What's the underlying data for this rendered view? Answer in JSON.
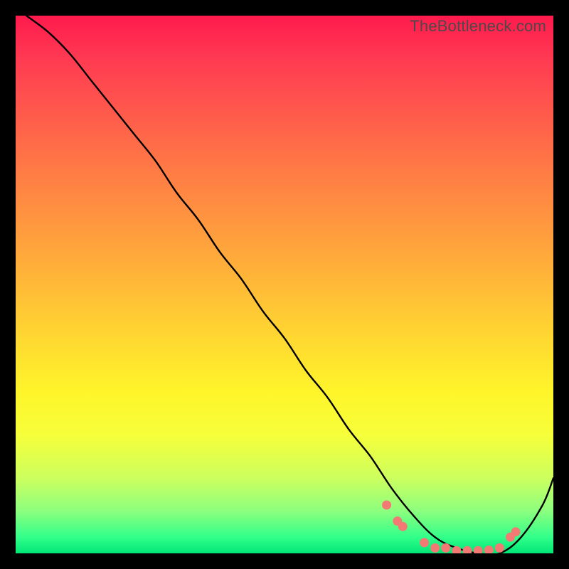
{
  "watermark": "TheBottleneck.com",
  "chart_data": {
    "type": "line",
    "title": "",
    "xlabel": "",
    "ylabel": "",
    "xlim": [
      0,
      100
    ],
    "ylim": [
      0,
      100
    ],
    "series": [
      {
        "name": "bottleneck-curve",
        "x": [
          2,
          6,
          10,
          14,
          18,
          22,
          26,
          30,
          34,
          38,
          42,
          46,
          50,
          54,
          58,
          62,
          66,
          70,
          74,
          78,
          82,
          86,
          90,
          94,
          98,
          100
        ],
        "y": [
          100,
          97,
          93,
          88,
          83,
          78,
          73,
          67,
          62,
          56,
          51,
          45,
          40,
          34,
          29,
          23,
          18,
          12,
          7,
          3,
          1,
          0,
          0,
          3,
          9,
          14
        ]
      }
    ],
    "markers": {
      "name": "highlight-dots",
      "color": "#f37a74",
      "points": [
        {
          "x": 69,
          "y": 9
        },
        {
          "x": 71,
          "y": 6
        },
        {
          "x": 72,
          "y": 5
        },
        {
          "x": 76,
          "y": 2
        },
        {
          "x": 78,
          "y": 1
        },
        {
          "x": 80,
          "y": 1
        },
        {
          "x": 82,
          "y": 0.5
        },
        {
          "x": 84,
          "y": 0.5
        },
        {
          "x": 86,
          "y": 0.5
        },
        {
          "x": 88,
          "y": 0.6
        },
        {
          "x": 90,
          "y": 1
        },
        {
          "x": 92,
          "y": 3
        },
        {
          "x": 93,
          "y": 4
        }
      ]
    },
    "gradient_stops": [
      {
        "pos": 0.0,
        "color": "#ff1a4d"
      },
      {
        "pos": 0.35,
        "color": "#ff8a42"
      },
      {
        "pos": 0.7,
        "color": "#fff52a"
      },
      {
        "pos": 0.92,
        "color": "#8eff7e"
      },
      {
        "pos": 1.0,
        "color": "#00e676"
      }
    ]
  }
}
